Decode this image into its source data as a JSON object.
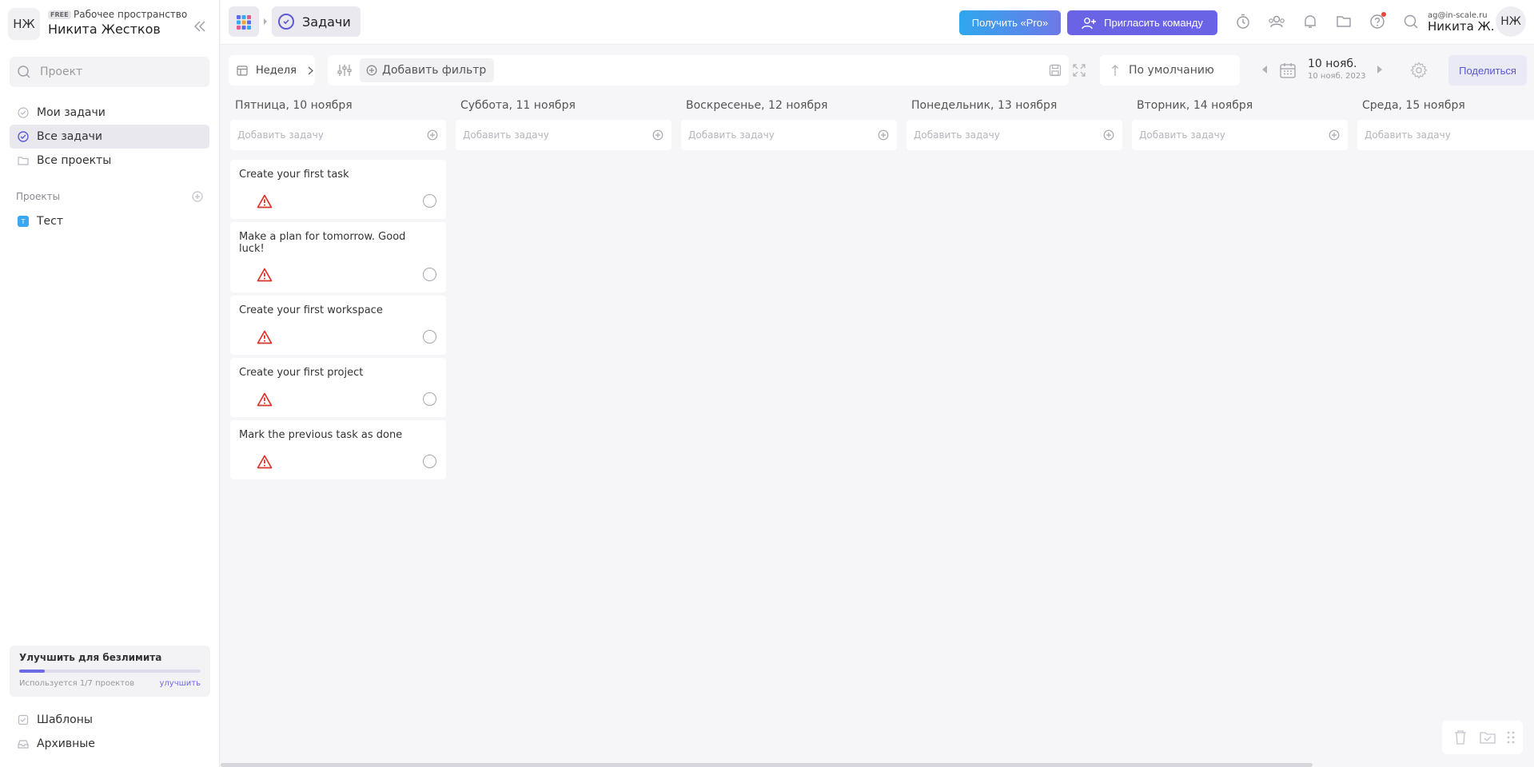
{
  "workspace": {
    "initials": "НЖ",
    "plan_badge": "FREE",
    "label": "Рабочее пространство",
    "owner_name": "Никита Жестков"
  },
  "sidebar": {
    "search_placeholder": "Проект",
    "nav": [
      {
        "label": "Мои задачи",
        "icon": "check-circle-icon",
        "active": false
      },
      {
        "label": "Все задачи",
        "icon": "check-circle-icon",
        "active": true
      },
      {
        "label": "Все проекты",
        "icon": "folder-icon",
        "active": false
      }
    ],
    "projects_section": "Проекты",
    "projects": [
      {
        "badge": "Т",
        "label": "Тест",
        "color": "#39a7f2"
      }
    ],
    "upgrade": {
      "title": "Улучшить для безлимита",
      "usage_text": "Используется 1/7 проектов",
      "usage_fraction": 0.143,
      "link": "улучшить"
    },
    "bottom": [
      {
        "label": "Шаблоны",
        "icon": "templates-icon"
      },
      {
        "label": "Архивные",
        "icon": "archive-icon"
      }
    ]
  },
  "header": {
    "breadcrumb_current": "Задачи",
    "get_pro": "Получить «Pro»",
    "invite": "Пригласить команду",
    "user_email": "ag@in-scale.ru",
    "user_name": "Никита Ж.",
    "user_initials": "НЖ"
  },
  "toolbar": {
    "view": "Неделя",
    "add_filter": "Добавить фильтр",
    "sort": "По умолчанию",
    "date_main": "10 нояб.",
    "date_sub": "10 нояб. 2023",
    "share": "Поделиться"
  },
  "columns": [
    {
      "title": "Пятница, 10 ноября",
      "add_placeholder": "Добавить задачу"
    },
    {
      "title": "Суббота, 11 ноября",
      "add_placeholder": "Добавить задачу"
    },
    {
      "title": "Воскресенье, 12 ноября",
      "add_placeholder": "Добавить задачу"
    },
    {
      "title": "Понедельник, 13 ноября",
      "add_placeholder": "Добавить задачу"
    },
    {
      "title": "Вторник, 14 ноября",
      "add_placeholder": "Добавить задачу"
    },
    {
      "title": "Среда, 15 ноября",
      "add_placeholder": "Добавить задачу"
    }
  ],
  "tasks": [
    {
      "title": "Create your first task",
      "priority": "high"
    },
    {
      "title": "Make a plan for tomorrow. Good luck!",
      "priority": "high"
    },
    {
      "title": "Create your first workspace",
      "priority": "high"
    },
    {
      "title": "Create your first project",
      "priority": "high"
    },
    {
      "title": "Mark the previous task as done",
      "priority": "high"
    }
  ],
  "colors": {
    "accent": "#6b63e6",
    "pro_gradient_start": "#2fa7ee",
    "warning": "#d9342b",
    "notification_dot": "#e8453c"
  }
}
